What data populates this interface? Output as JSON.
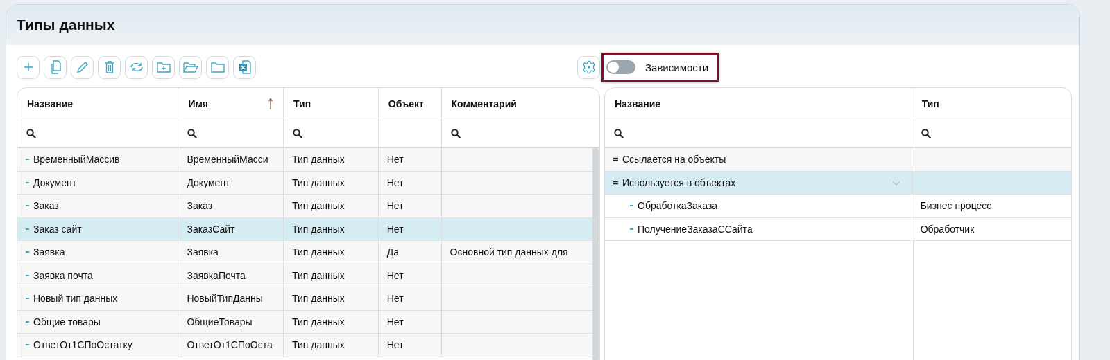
{
  "title": "Типы данных",
  "toolbar": [
    {
      "kind": "add"
    },
    {
      "kind": "copy"
    },
    {
      "kind": "edit"
    },
    {
      "kind": "delete"
    },
    {
      "kind": "refresh"
    },
    {
      "kind": "new-folder"
    },
    {
      "kind": "open-folder"
    },
    {
      "kind": "folder"
    },
    {
      "kind": "excel"
    }
  ],
  "dependencies_toggle": {
    "label": "Зависимости",
    "on": false,
    "highlighted": true
  },
  "types_table": {
    "columns": [
      {
        "title": "Название",
        "sorted": false,
        "filter": true
      },
      {
        "title": "Имя",
        "sorted": true,
        "filter": true
      },
      {
        "title": "Тип",
        "sorted": false,
        "filter": true
      },
      {
        "title": "Объект",
        "sorted": false,
        "filter": false
      },
      {
        "title": "Комментарий",
        "sorted": false,
        "filter": true
      }
    ],
    "rows": [
      {
        "name": "ВременныйМассив",
        "ident": "ВременныйМасси",
        "type": "Тип данных",
        "object": "Нет",
        "selected": false
      },
      {
        "name": "Документ",
        "ident": "Документ",
        "type": "Тип данных",
        "object": "Нет",
        "selected": false
      },
      {
        "name": "Заказ",
        "ident": "Заказ",
        "type": "Тип данных",
        "object": "Нет",
        "selected": false
      },
      {
        "name": "Заказ сайт",
        "ident": "ЗаказСайт",
        "type": "Тип данных",
        "object": "Нет",
        "selected": true
      },
      {
        "name": "Заявка",
        "ident": "Заявка",
        "type": "Тип данных",
        "object": "Да",
        "comment": "Основной тип данных для",
        "selected": false
      },
      {
        "name": "Заявка почта",
        "ident": "ЗаявкаПочта",
        "type": "Тип данных",
        "object": "Нет",
        "selected": false
      },
      {
        "name": "Новый тип данных",
        "ident": "НовыйТипДанны",
        "type": "Тип данных",
        "object": "Нет",
        "selected": false
      },
      {
        "name": "Общие товары",
        "ident": "ОбщиеТовары",
        "type": "Тип данных",
        "object": "Нет",
        "selected": false
      },
      {
        "name": "ОтветОт1СПоОстатку",
        "ident": "ОтветОт1СПоОста",
        "type": "Тип данных",
        "object": "Нет",
        "selected": false
      }
    ]
  },
  "dependencies_table": {
    "columns": [
      {
        "title": "Название",
        "filter": true
      },
      {
        "title": "Тип",
        "filter": true
      }
    ],
    "rows": [
      {
        "title": "Ссылается на объекты",
        "selected": false
      },
      {
        "title": "Используется в объектах",
        "selected": true,
        "expanded": true,
        "children": [
          {
            "title": "ОбработкаЗаказа",
            "type": "Бизнес процесс"
          },
          {
            "title": "ПолучениеЗаказаССайта",
            "type": "Обработчик"
          }
        ]
      }
    ]
  }
}
